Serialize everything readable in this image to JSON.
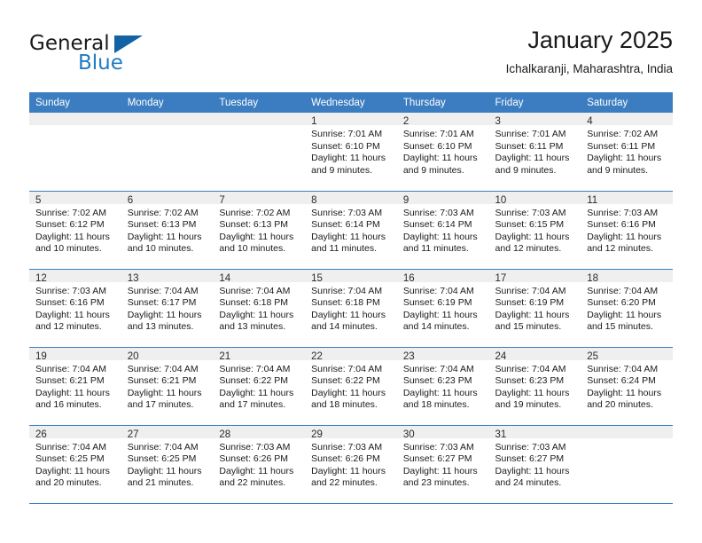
{
  "brand": {
    "name_part1": "General",
    "name_part2": "Blue",
    "accent_color": "#1163a6",
    "blue_text_color": "#1f7ac4"
  },
  "header": {
    "title": "January 2025",
    "location": "Ichalkaranji, Maharashtra, India",
    "header_bg_color": "#3b7dc0",
    "daynum_bg_color": "#efeff0"
  },
  "weekdays": [
    "Sunday",
    "Monday",
    "Tuesday",
    "Wednesday",
    "Thursday",
    "Friday",
    "Saturday"
  ],
  "weeks": [
    [
      {
        "day": "",
        "sunrise": "",
        "sunset": "",
        "daylight1": "",
        "daylight2": ""
      },
      {
        "day": "",
        "sunrise": "",
        "sunset": "",
        "daylight1": "",
        "daylight2": ""
      },
      {
        "day": "",
        "sunrise": "",
        "sunset": "",
        "daylight1": "",
        "daylight2": ""
      },
      {
        "day": "1",
        "sunrise": "Sunrise: 7:01 AM",
        "sunset": "Sunset: 6:10 PM",
        "daylight1": "Daylight: 11 hours",
        "daylight2": "and 9 minutes."
      },
      {
        "day": "2",
        "sunrise": "Sunrise: 7:01 AM",
        "sunset": "Sunset: 6:10 PM",
        "daylight1": "Daylight: 11 hours",
        "daylight2": "and 9 minutes."
      },
      {
        "day": "3",
        "sunrise": "Sunrise: 7:01 AM",
        "sunset": "Sunset: 6:11 PM",
        "daylight1": "Daylight: 11 hours",
        "daylight2": "and 9 minutes."
      },
      {
        "day": "4",
        "sunrise": "Sunrise: 7:02 AM",
        "sunset": "Sunset: 6:11 PM",
        "daylight1": "Daylight: 11 hours",
        "daylight2": "and 9 minutes."
      }
    ],
    [
      {
        "day": "5",
        "sunrise": "Sunrise: 7:02 AM",
        "sunset": "Sunset: 6:12 PM",
        "daylight1": "Daylight: 11 hours",
        "daylight2": "and 10 minutes."
      },
      {
        "day": "6",
        "sunrise": "Sunrise: 7:02 AM",
        "sunset": "Sunset: 6:13 PM",
        "daylight1": "Daylight: 11 hours",
        "daylight2": "and 10 minutes."
      },
      {
        "day": "7",
        "sunrise": "Sunrise: 7:02 AM",
        "sunset": "Sunset: 6:13 PM",
        "daylight1": "Daylight: 11 hours",
        "daylight2": "and 10 minutes."
      },
      {
        "day": "8",
        "sunrise": "Sunrise: 7:03 AM",
        "sunset": "Sunset: 6:14 PM",
        "daylight1": "Daylight: 11 hours",
        "daylight2": "and 11 minutes."
      },
      {
        "day": "9",
        "sunrise": "Sunrise: 7:03 AM",
        "sunset": "Sunset: 6:14 PM",
        "daylight1": "Daylight: 11 hours",
        "daylight2": "and 11 minutes."
      },
      {
        "day": "10",
        "sunrise": "Sunrise: 7:03 AM",
        "sunset": "Sunset: 6:15 PM",
        "daylight1": "Daylight: 11 hours",
        "daylight2": "and 12 minutes."
      },
      {
        "day": "11",
        "sunrise": "Sunrise: 7:03 AM",
        "sunset": "Sunset: 6:16 PM",
        "daylight1": "Daylight: 11 hours",
        "daylight2": "and 12 minutes."
      }
    ],
    [
      {
        "day": "12",
        "sunrise": "Sunrise: 7:03 AM",
        "sunset": "Sunset: 6:16 PM",
        "daylight1": "Daylight: 11 hours",
        "daylight2": "and 12 minutes."
      },
      {
        "day": "13",
        "sunrise": "Sunrise: 7:04 AM",
        "sunset": "Sunset: 6:17 PM",
        "daylight1": "Daylight: 11 hours",
        "daylight2": "and 13 minutes."
      },
      {
        "day": "14",
        "sunrise": "Sunrise: 7:04 AM",
        "sunset": "Sunset: 6:18 PM",
        "daylight1": "Daylight: 11 hours",
        "daylight2": "and 13 minutes."
      },
      {
        "day": "15",
        "sunrise": "Sunrise: 7:04 AM",
        "sunset": "Sunset: 6:18 PM",
        "daylight1": "Daylight: 11 hours",
        "daylight2": "and 14 minutes."
      },
      {
        "day": "16",
        "sunrise": "Sunrise: 7:04 AM",
        "sunset": "Sunset: 6:19 PM",
        "daylight1": "Daylight: 11 hours",
        "daylight2": "and 14 minutes."
      },
      {
        "day": "17",
        "sunrise": "Sunrise: 7:04 AM",
        "sunset": "Sunset: 6:19 PM",
        "daylight1": "Daylight: 11 hours",
        "daylight2": "and 15 minutes."
      },
      {
        "day": "18",
        "sunrise": "Sunrise: 7:04 AM",
        "sunset": "Sunset: 6:20 PM",
        "daylight1": "Daylight: 11 hours",
        "daylight2": "and 15 minutes."
      }
    ],
    [
      {
        "day": "19",
        "sunrise": "Sunrise: 7:04 AM",
        "sunset": "Sunset: 6:21 PM",
        "daylight1": "Daylight: 11 hours",
        "daylight2": "and 16 minutes."
      },
      {
        "day": "20",
        "sunrise": "Sunrise: 7:04 AM",
        "sunset": "Sunset: 6:21 PM",
        "daylight1": "Daylight: 11 hours",
        "daylight2": "and 17 minutes."
      },
      {
        "day": "21",
        "sunrise": "Sunrise: 7:04 AM",
        "sunset": "Sunset: 6:22 PM",
        "daylight1": "Daylight: 11 hours",
        "daylight2": "and 17 minutes."
      },
      {
        "day": "22",
        "sunrise": "Sunrise: 7:04 AM",
        "sunset": "Sunset: 6:22 PM",
        "daylight1": "Daylight: 11 hours",
        "daylight2": "and 18 minutes."
      },
      {
        "day": "23",
        "sunrise": "Sunrise: 7:04 AM",
        "sunset": "Sunset: 6:23 PM",
        "daylight1": "Daylight: 11 hours",
        "daylight2": "and 18 minutes."
      },
      {
        "day": "24",
        "sunrise": "Sunrise: 7:04 AM",
        "sunset": "Sunset: 6:23 PM",
        "daylight1": "Daylight: 11 hours",
        "daylight2": "and 19 minutes."
      },
      {
        "day": "25",
        "sunrise": "Sunrise: 7:04 AM",
        "sunset": "Sunset: 6:24 PM",
        "daylight1": "Daylight: 11 hours",
        "daylight2": "and 20 minutes."
      }
    ],
    [
      {
        "day": "26",
        "sunrise": "Sunrise: 7:04 AM",
        "sunset": "Sunset: 6:25 PM",
        "daylight1": "Daylight: 11 hours",
        "daylight2": "and 20 minutes."
      },
      {
        "day": "27",
        "sunrise": "Sunrise: 7:04 AM",
        "sunset": "Sunset: 6:25 PM",
        "daylight1": "Daylight: 11 hours",
        "daylight2": "and 21 minutes."
      },
      {
        "day": "28",
        "sunrise": "Sunrise: 7:03 AM",
        "sunset": "Sunset: 6:26 PM",
        "daylight1": "Daylight: 11 hours",
        "daylight2": "and 22 minutes."
      },
      {
        "day": "29",
        "sunrise": "Sunrise: 7:03 AM",
        "sunset": "Sunset: 6:26 PM",
        "daylight1": "Daylight: 11 hours",
        "daylight2": "and 22 minutes."
      },
      {
        "day": "30",
        "sunrise": "Sunrise: 7:03 AM",
        "sunset": "Sunset: 6:27 PM",
        "daylight1": "Daylight: 11 hours",
        "daylight2": "and 23 minutes."
      },
      {
        "day": "31",
        "sunrise": "Sunrise: 7:03 AM",
        "sunset": "Sunset: 6:27 PM",
        "daylight1": "Daylight: 11 hours",
        "daylight2": "and 24 minutes."
      },
      {
        "day": "",
        "sunrise": "",
        "sunset": "",
        "daylight1": "",
        "daylight2": ""
      }
    ]
  ]
}
